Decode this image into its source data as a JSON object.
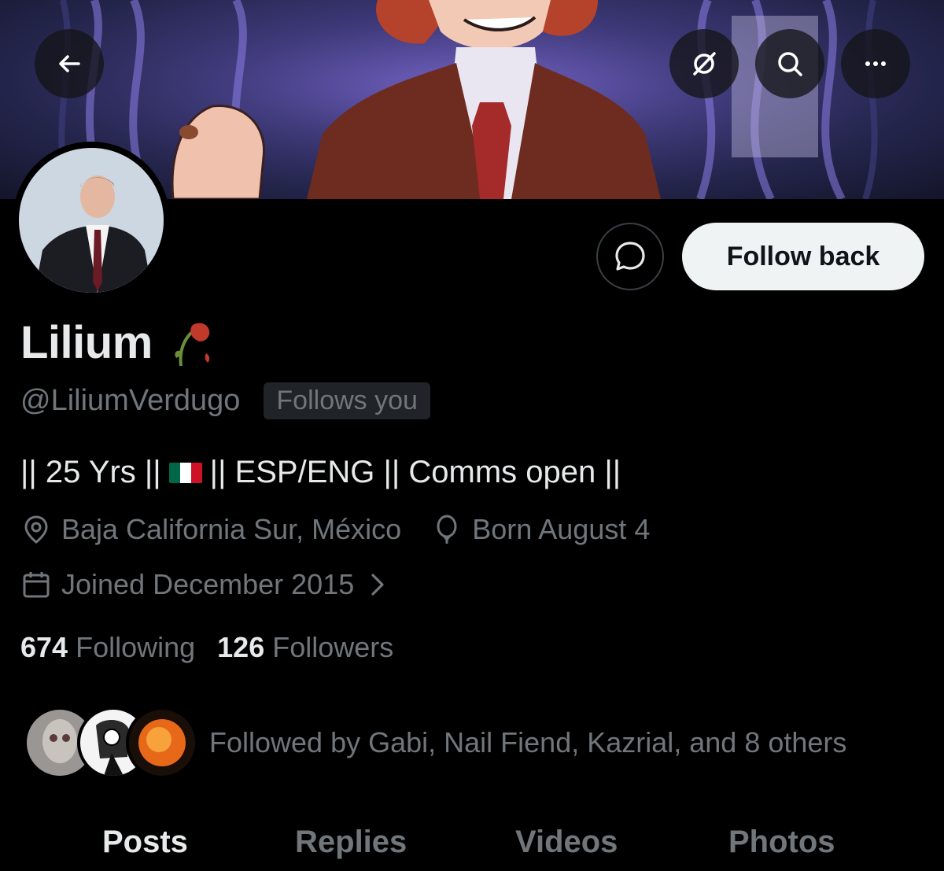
{
  "header": {
    "back_icon": "arrow-left-icon",
    "translate_icon": "grok-icon",
    "search_icon": "search-icon",
    "more_icon": "more-icon"
  },
  "actions": {
    "message_icon": "message-icon",
    "follow_label": "Follow back"
  },
  "profile": {
    "name": "Lilium",
    "handle": "@LiliumVerdugo",
    "follows_you": "Follows you",
    "bio_part1": "|| 25 Yrs ||",
    "bio_part2": "|| ESP/ENG || Comms open ||",
    "location": "Baja California Sur, México",
    "birthday": "Born August 4",
    "joined": "Joined December 2015"
  },
  "stats": {
    "following_count": "674",
    "following_label": "Following",
    "followers_count": "126",
    "followers_label": "Followers"
  },
  "followed_by": "Followed by Gabi, Nail Fiend, Kazrial, and 8 others",
  "tabs": [
    "Posts",
    "Replies",
    "Videos",
    "Photos"
  ],
  "colors": {
    "background": "#000000",
    "text_primary": "#e7e9ea",
    "text_secondary": "#71767b",
    "button_bg": "#eff3f4"
  }
}
